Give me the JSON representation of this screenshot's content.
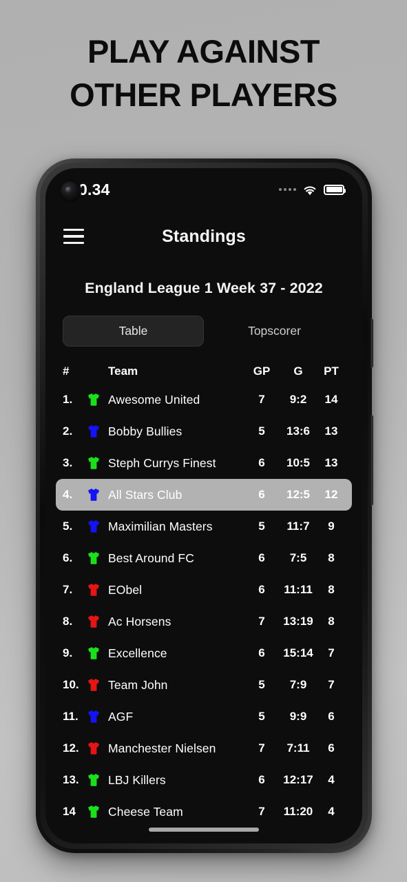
{
  "promo": {
    "line1": "PLAY AGAINST",
    "line2": "OTHER PLAYERS"
  },
  "status_bar": {
    "time": "0.34",
    "signal_icon": "signal-dots-icon",
    "wifi_icon": "wifi-icon",
    "battery_icon": "battery-full-icon"
  },
  "app_bar": {
    "menu_icon": "hamburger-menu-icon",
    "title": "Standings"
  },
  "league": {
    "title": "England League 1 Week 37 - 2022"
  },
  "tabs": [
    {
      "label": "Table",
      "active": true
    },
    {
      "label": "Topscorer",
      "active": false
    }
  ],
  "table": {
    "headers": {
      "rank": "#",
      "team": "Team",
      "gp": "GP",
      "g": "G",
      "pt": "PT"
    },
    "rows": [
      {
        "rank": "1.",
        "shirt": "green",
        "team": "Awesome United",
        "gp": "7",
        "g": "9:2",
        "pt": "14",
        "highlight": false
      },
      {
        "rank": "2.",
        "shirt": "blue",
        "team": "Bobby Bullies",
        "gp": "5",
        "g": "13:6",
        "pt": "13",
        "highlight": false
      },
      {
        "rank": "3.",
        "shirt": "green",
        "team": "Steph Currys Finest",
        "gp": "6",
        "g": "10:5",
        "pt": "13",
        "highlight": false
      },
      {
        "rank": "4.",
        "shirt": "blue",
        "team": "All Stars Club",
        "gp": "6",
        "g": "12:5",
        "pt": "12",
        "highlight": true
      },
      {
        "rank": "5.",
        "shirt": "blue",
        "team": "Maximilian Masters",
        "gp": "5",
        "g": "11:7",
        "pt": "9",
        "highlight": false
      },
      {
        "rank": "6.",
        "shirt": "green",
        "team": "Best Around FC",
        "gp": "6",
        "g": "7:5",
        "pt": "8",
        "highlight": false
      },
      {
        "rank": "7.",
        "shirt": "red",
        "team": "EObel",
        "gp": "6",
        "g": "11:11",
        "pt": "8",
        "highlight": false
      },
      {
        "rank": "8.",
        "shirt": "red",
        "team": "Ac Horsens",
        "gp": "7",
        "g": "13:19",
        "pt": "8",
        "highlight": false
      },
      {
        "rank": "9.",
        "shirt": "green",
        "team": "Excellence",
        "gp": "6",
        "g": "15:14",
        "pt": "7",
        "highlight": false
      },
      {
        "rank": "10.",
        "shirt": "red",
        "team": "Team John",
        "gp": "5",
        "g": "7:9",
        "pt": "7",
        "highlight": false
      },
      {
        "rank": "11.",
        "shirt": "blue",
        "team": "AGF",
        "gp": "5",
        "g": "9:9",
        "pt": "6",
        "highlight": false
      },
      {
        "rank": "12.",
        "shirt": "red",
        "team": "Manchester Nielsen",
        "gp": "7",
        "g": "7:11",
        "pt": "6",
        "highlight": false
      },
      {
        "rank": "13.",
        "shirt": "green",
        "team": "LBJ Killers",
        "gp": "6",
        "g": "12:17",
        "pt": "4",
        "highlight": false
      },
      {
        "rank": "14",
        "shirt": "green",
        "team": "Cheese Team",
        "gp": "7",
        "g": "11:20",
        "pt": "4",
        "highlight": false
      }
    ]
  },
  "colors": {
    "shirt_green": "#1ae01a",
    "shirt_blue": "#1313f5",
    "shirt_red": "#e51515",
    "screen_bg": "#0d0d0d",
    "highlight_row": "#b2b2b2",
    "tab_active_bg": "#242424",
    "page_bg": "#b4b4b4"
  },
  "home_indicator": "home-indicator-bar"
}
